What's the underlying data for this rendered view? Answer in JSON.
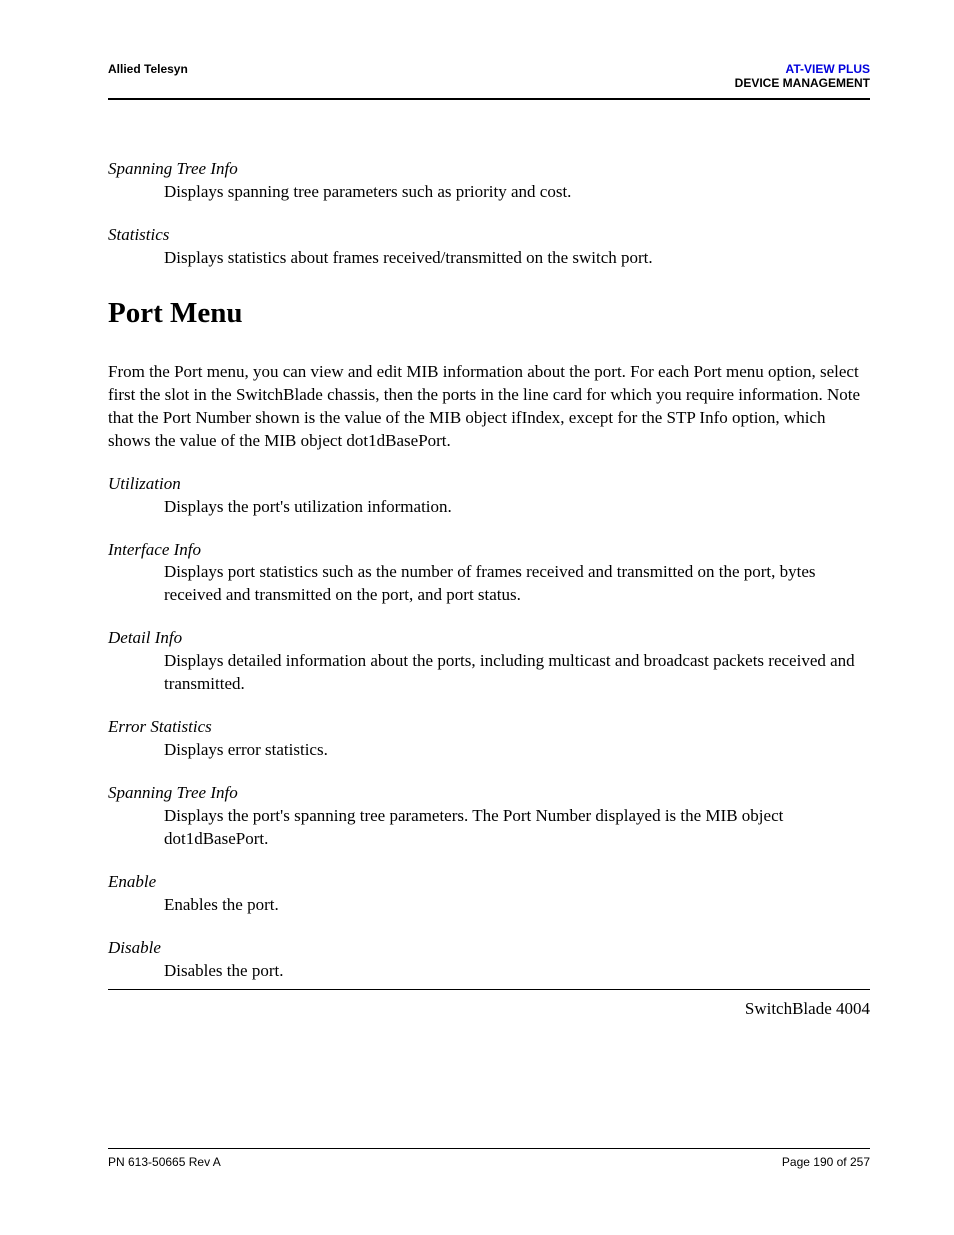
{
  "header": {
    "left": "Allied Telesyn",
    "right_top": "AT-VIEW PLUS",
    "right_bottom": "DEVICE MANAGEMENT"
  },
  "definitions_top": [
    {
      "term": "Spanning Tree Info",
      "desc": "Displays spanning tree parameters such as priority and cost."
    },
    {
      "term": "Statistics",
      "desc": "Displays statistics about frames received/transmitted on the switch port."
    }
  ],
  "section": {
    "heading": "Port Menu",
    "paragraph": "From the Port menu, you can view and edit MIB information about the port. For each Port menu option, select first the slot in the SwitchBlade chassis, then the ports in the line card for which you require information. Note that the Port Number shown is the value of the MIB object ifIndex, except for the STP Info option, which shows the value of the MIB object dot1dBasePort."
  },
  "definitions_bottom": [
    {
      "term": "Utilization",
      "desc": "Displays the port's utilization information."
    },
    {
      "term": "Interface Info",
      "desc": "Displays port statistics such as the number of frames received and transmitted on the port, bytes received and transmitted on the port, and port status."
    },
    {
      "term": "Detail Info",
      "desc": "Displays detailed information about the ports, including multicast and broadcast packets received and transmitted."
    },
    {
      "term": "Error Statistics",
      "desc": "Displays error statistics."
    },
    {
      "term": "Spanning Tree Info",
      "desc": "Displays the port's spanning tree parameters. The Port Number displayed is the MIB object dot1dBasePort."
    },
    {
      "term": "Enable",
      "desc": "Enables the port."
    },
    {
      "term": "Disable",
      "desc": "Disables the port."
    }
  ],
  "model": "SwitchBlade 4004",
  "footer": {
    "left": "PN 613-50665 Rev A",
    "right": "Page 190 of 257"
  }
}
